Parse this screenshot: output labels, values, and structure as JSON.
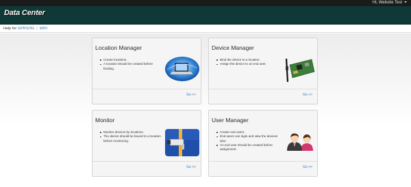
{
  "topbar": {
    "user_label": "Hi,  Website Test"
  },
  "header": {
    "brand": "Data Center"
  },
  "helpbar": {
    "prefix": "Help for",
    "link1": "GPRS/3G",
    "link2": "WIFI"
  },
  "cards": [
    {
      "title": "Location Manager",
      "bullets": [
        "Create locations.",
        "A location should be created before binding."
      ],
      "link": "Go >>",
      "icon": "laptop-globe-icon"
    },
    {
      "title": "Device Manager",
      "bullets": [
        "Bind the device to a location.",
        "Assign the device to an end user."
      ],
      "link": "Go >>",
      "icon": "circuit-board-icon"
    },
    {
      "title": "Monitor",
      "bullets": [
        "Monitor devices by locations.",
        "The device should be bound to a location before monitoring."
      ],
      "link": "Go >>",
      "icon": "security-camera-icon"
    },
    {
      "title": "User Manager",
      "bullets": [
        "Create end users.",
        "End users can login and view the devices also.",
        "An end user should be created before assignment."
      ],
      "link": "Go >>",
      "icon": "users-icon"
    }
  ],
  "colors": {
    "header_bg": "#0f3837",
    "topbar_bg": "#1b1b1b",
    "link": "#3574b8",
    "card_bg": "#f5f5f5"
  }
}
